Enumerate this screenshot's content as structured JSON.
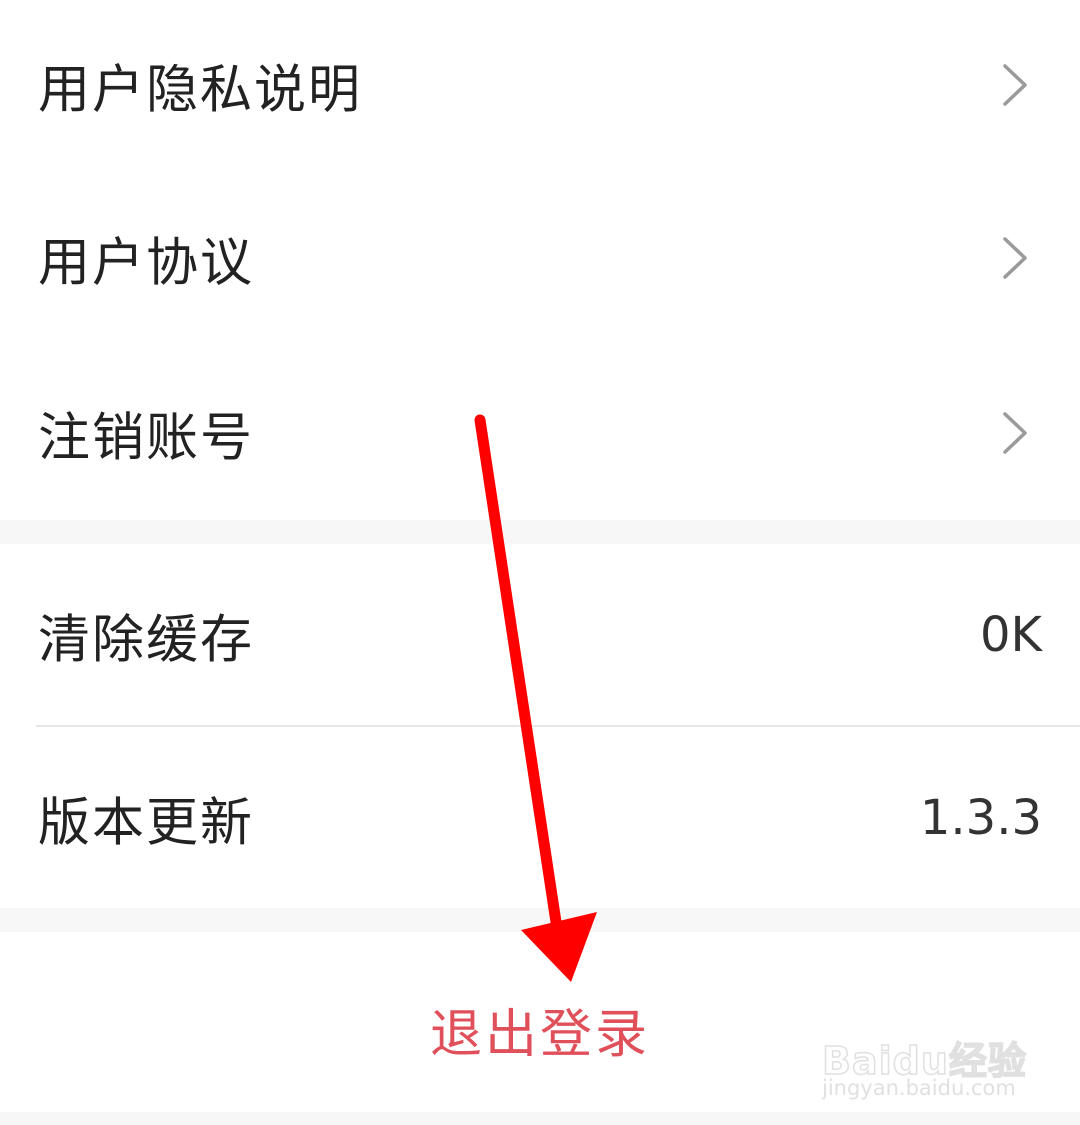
{
  "menu_group_1": {
    "items": [
      {
        "label": "用户隐私说明",
        "icon": "chevron-right-icon"
      },
      {
        "label": "用户协议",
        "icon": "chevron-right-icon"
      },
      {
        "label": "注销账号",
        "icon": "chevron-right-icon"
      }
    ]
  },
  "menu_group_2": {
    "clear_cache": {
      "label": "清除缓存",
      "value": "0K"
    },
    "version_update": {
      "label": "版本更新",
      "value": "1.3.3"
    }
  },
  "logout": {
    "label": "退出登录"
  },
  "annotation": {
    "arrow_color": "#ff0000",
    "icon": "arrow-down-icon"
  },
  "watermark": {
    "logo_text": "Baidu经验",
    "url_text": "jingyan.baidu.com"
  },
  "colors": {
    "logout_text": "#e0505a",
    "section_gap": "#f7f7f7",
    "divider": "#e6e6e6",
    "label_text": "#222222"
  }
}
